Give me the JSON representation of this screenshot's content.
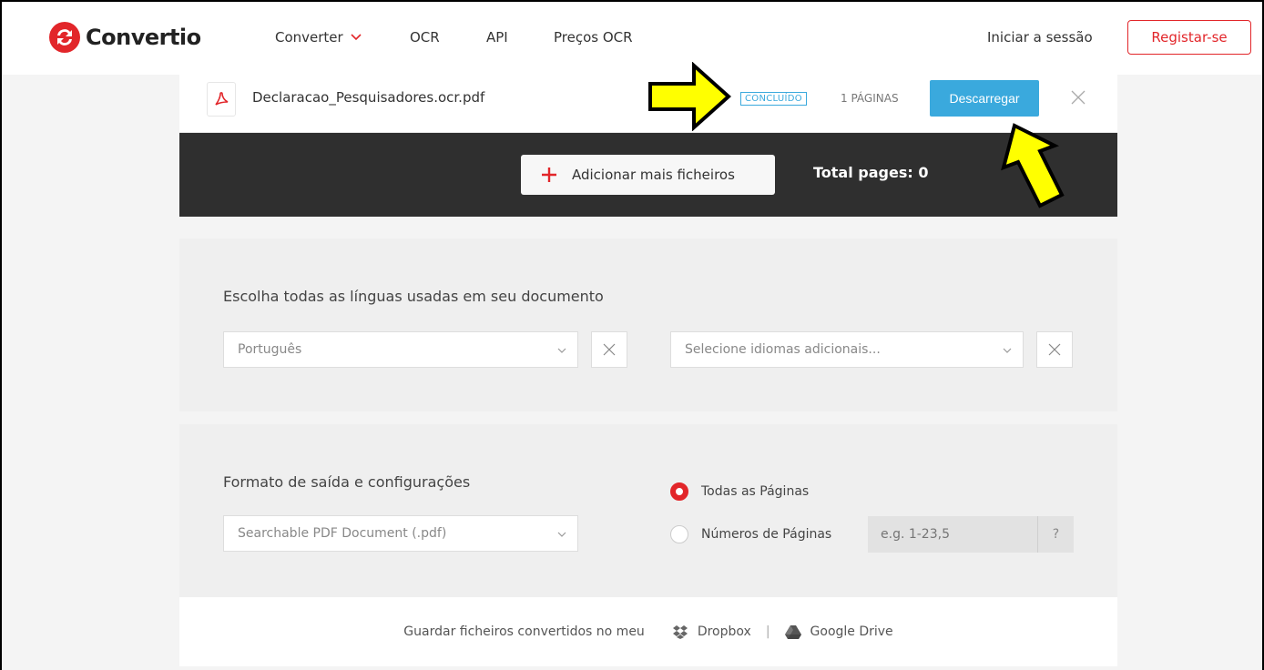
{
  "header": {
    "brand": "Convertio",
    "nav": {
      "converter": "Converter",
      "ocr": "OCR",
      "api": "API",
      "pricing": "Preços OCR"
    },
    "login": "Iniciar a sessão",
    "register": "Registar-se"
  },
  "file": {
    "name": "Declaracao_Pesquisadores.ocr.pdf",
    "status": "CONCLUÍDO",
    "pages": "1 PÁGINAS",
    "download": "Descarregar"
  },
  "toolbar": {
    "add_files": "Adicionar mais ficheiros",
    "total_pages": "Total pages: 0"
  },
  "languages": {
    "title": "Escolha todas as línguas usadas em seu documento",
    "primary": "Português",
    "additional_placeholder": "Selecione idiomas adicionais..."
  },
  "output": {
    "title": "Formato de saída e configurações",
    "format": "Searchable PDF Document (.pdf)",
    "all_pages": "Todas as Páginas",
    "page_numbers": "Números de Páginas",
    "range_placeholder": "e.g. 1-23,5",
    "help": "?"
  },
  "save": {
    "label": "Guardar ficheiros convertidos no meu",
    "dropbox": "Dropbox",
    "separator": "|",
    "gdrive": "Google Drive"
  },
  "colors": {
    "brand_red": "#e2262a",
    "accent_blue": "#3aa9dd",
    "dark_band": "#2f2f2f",
    "annotation_yellow": "#ffff00"
  }
}
